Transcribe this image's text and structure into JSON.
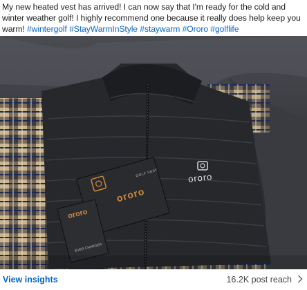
{
  "post": {
    "text": "My new heated vest has arrived! I can now say that I'm ready for the cold and winter weather golf! I highly recommend one because it really does help keep you warm!",
    "hashtags": [
      "#wintergolf",
      "#StayWarmInStyle",
      "#staywarm",
      "#Ororo",
      "#golflife"
    ]
  },
  "image": {
    "vest_logo": "ororo",
    "box_large_brand": "ororo",
    "box_large_subtext": "GOLF VEST",
    "box_small_brand": "ororo",
    "box_small_subtext": "EVER CHARGER"
  },
  "footer": {
    "insights_label": "View insights",
    "reach_label": "16.2K post reach",
    "chevron_icon": "chevron-right-icon"
  },
  "colors": {
    "link": "#0a66c2",
    "vest": "#25272b",
    "box_accent": "#d0893a"
  }
}
